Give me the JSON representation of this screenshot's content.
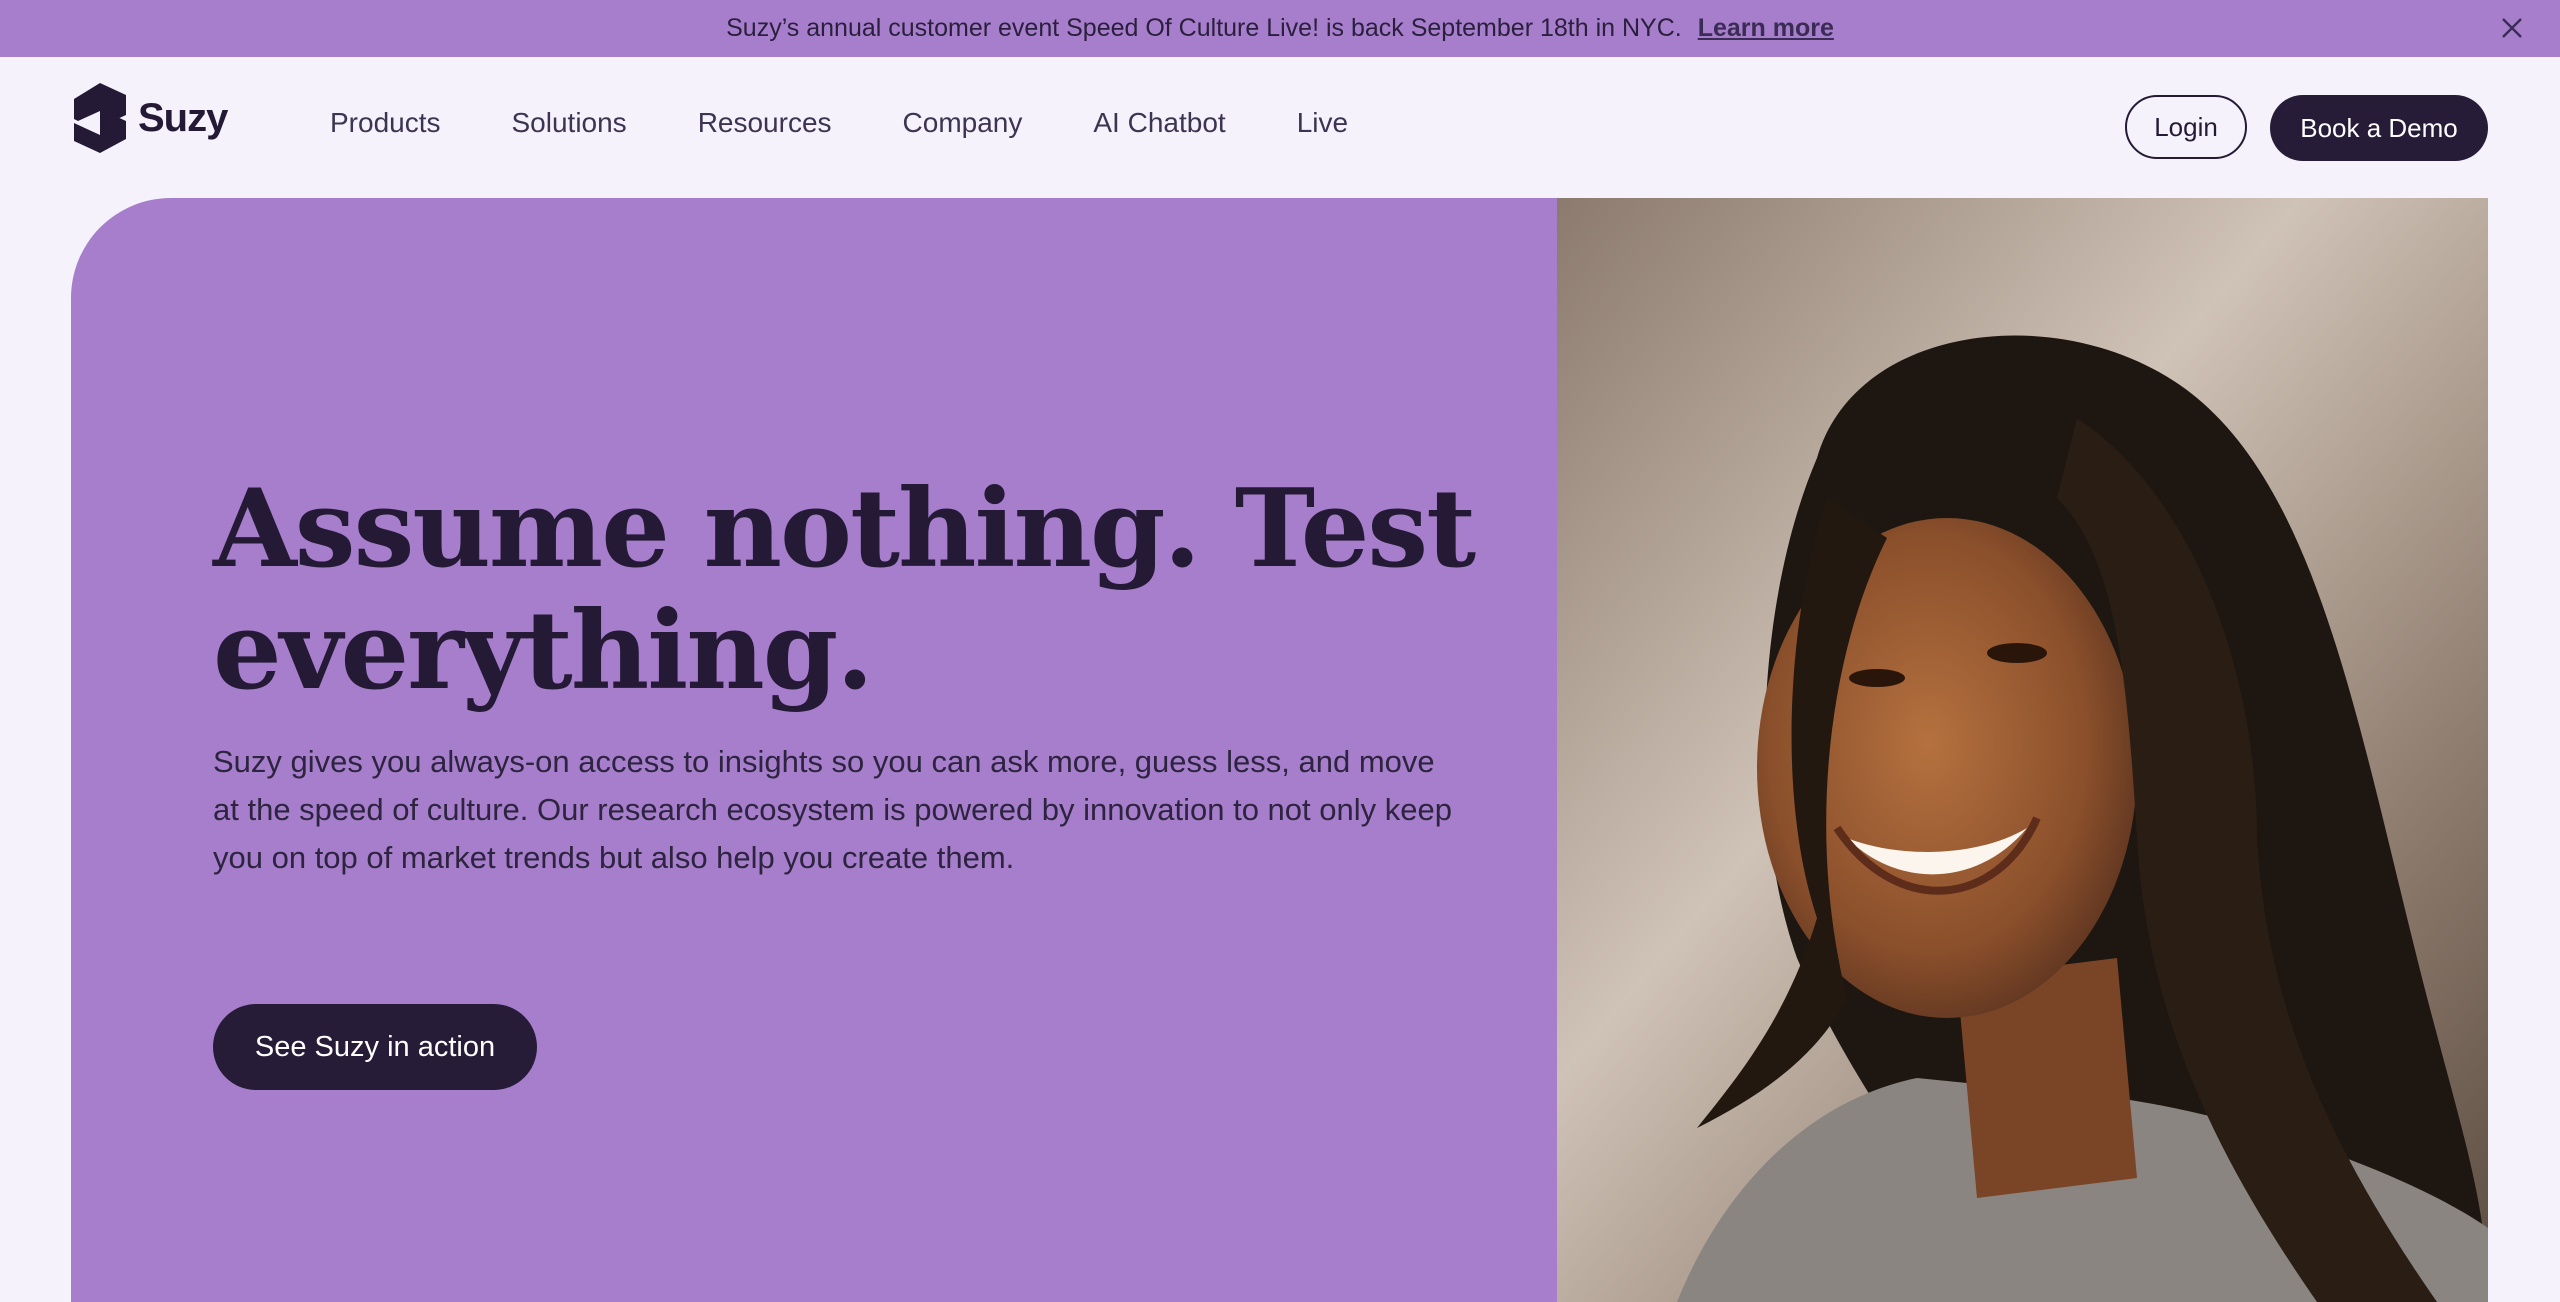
{
  "announcement": {
    "message": "Suzy’s annual customer event Speed Of Culture Live! is back September 18th in NYC.",
    "link_label": "Learn more",
    "close_icon": "close-icon"
  },
  "header": {
    "logo_text": "Suzy",
    "logo_icon": "suzy-logo-icon",
    "nav": [
      {
        "label": "Products"
      },
      {
        "label": "Solutions"
      },
      {
        "label": "Resources"
      },
      {
        "label": "Company"
      },
      {
        "label": "AI Chatbot"
      },
      {
        "label": "Live"
      }
    ],
    "login_label": "Login",
    "demo_label": "Book a Demo"
  },
  "hero": {
    "headline": "Assume nothing. Test everything.",
    "description": "Suzy gives you always-on access to insights so you can ask more, guess less, and move at the speed of culture. Our research ecosystem is powered by innovation to not only keep you on top of market trends but also help you create them.",
    "cta_label": "See Suzy in action"
  },
  "colors": {
    "accent_purple": "#a77ecb",
    "dark": "#261c38",
    "background": "#f6f2fb"
  }
}
